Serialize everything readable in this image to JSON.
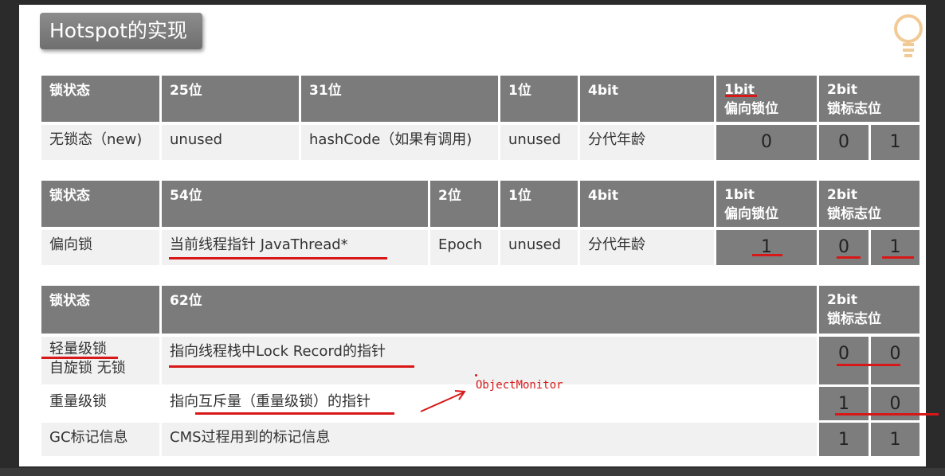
{
  "title": "Hotspot的实现",
  "table1": {
    "headers": [
      "锁状态",
      "25位",
      "31位",
      "1位",
      "4bit",
      "1bit",
      "偏向锁位",
      "2bit",
      "锁标志位"
    ],
    "row": [
      "无锁态（new)",
      "unused",
      "hashCode（如果有调用)",
      "unused",
      "分代年龄",
      "0",
      "0",
      "1"
    ]
  },
  "table2": {
    "headers": [
      "锁状态",
      "54位",
      "2位",
      "1位",
      "4bit",
      "1bit",
      "偏向锁位",
      "2bit",
      "锁标志位"
    ],
    "row": [
      "偏向锁",
      "当前线程指针 JavaThread*",
      "Epoch",
      "unused",
      "分代年龄",
      "1",
      "0",
      "1"
    ]
  },
  "table3": {
    "headers": [
      "锁状态",
      "62位",
      "2bit",
      "锁标志位"
    ],
    "rows": [
      {
        "state": "轻量级锁",
        "state2": "自旋锁 无锁",
        "desc": "指向线程栈中Lock Record的指针",
        "b1": "0",
        "b2": "0"
      },
      {
        "state": "重量级锁",
        "desc": "指向互斥量（重量级锁）的指针",
        "b1": "1",
        "b2": "0"
      },
      {
        "state": "GC标记信息",
        "desc": "CMS过程用到的标记信息",
        "b1": "1",
        "b2": "1"
      }
    ]
  },
  "annotation": "ObjectMonitor",
  "colors": {
    "header": "#7b7b7b",
    "row": "#f1f1f1",
    "ink": "#d81818"
  }
}
